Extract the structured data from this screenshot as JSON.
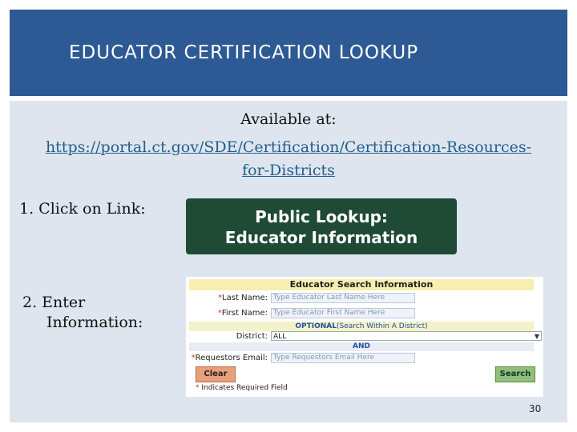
{
  "slide": {
    "title": "EDUCATOR CERTIFICATION LOOKUP",
    "available_text": "Available at:",
    "url": "https://portal.ct.gov/SDE/Certification/Certification-Resources-for-Districts",
    "step1_label": "1. Click on Link:",
    "link_button": {
      "line1": "Public Lookup:",
      "line2": "Educator Information"
    },
    "step2_line1": "2. Enter",
    "step2_line2": "Information:",
    "page_number": "30"
  },
  "form": {
    "header": "Educator Search Information",
    "last_name": {
      "label": "Last Name:",
      "placeholder": "Type Educator Last Name Here"
    },
    "first_name": {
      "label": "First Name:",
      "placeholder": "Type Educator First Name Here"
    },
    "optional_strong": "OPTIONAL",
    "optional_rest": "(Search Within A District)",
    "district": {
      "label": "District:",
      "value": "ALL"
    },
    "and_text": "AND",
    "requestor_email": {
      "label": "Requestors Email:",
      "placeholder": "Type Requestors Email Here"
    },
    "clear_label": "Clear",
    "search_label": "Search",
    "required_mark": "*",
    "footnote": "Indicates Required Field"
  },
  "colors": {
    "title_bar": "#2d5a94",
    "content_bg": "#dfe5ee",
    "link_button": "#1f4a36",
    "url": "#1f5f8b"
  }
}
